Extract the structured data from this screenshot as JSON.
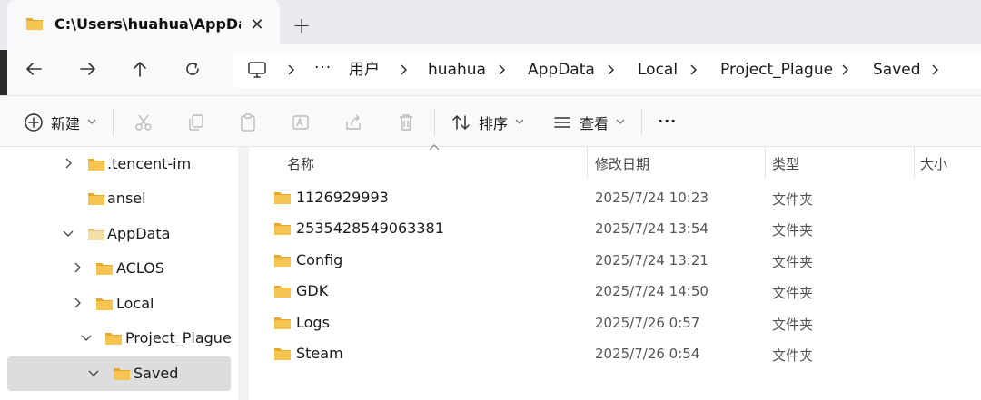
{
  "tab": {
    "title": "C:\\Users\\huahua\\AppData\\",
    "close_glyph": "✕",
    "new_tab_glyph": "+"
  },
  "nav": {
    "back_icon": "arrow-left-icon",
    "forward_icon": "arrow-right-icon",
    "up_icon": "arrow-up-icon",
    "refresh_icon": "refresh-icon"
  },
  "address": {
    "overflow": "···",
    "crumbs": [
      "用户",
      "huahua",
      "AppData",
      "Local",
      "Project_Plague",
      "Saved"
    ]
  },
  "toolbar": {
    "new_label": "新建",
    "sort_label": "排序",
    "view_label": "查看",
    "more_label": "···"
  },
  "sidebar": {
    "items": [
      {
        "label": ".tencent-im"
      },
      {
        "label": "ansel"
      },
      {
        "label": "AppData"
      },
      {
        "label": "ACLOS"
      },
      {
        "label": "Local"
      },
      {
        "label": "Project_Plague"
      },
      {
        "label": "Saved"
      }
    ]
  },
  "columns": {
    "name": "名称",
    "modified": "修改日期",
    "type": "类型",
    "size": "大小"
  },
  "files": [
    {
      "name": "1126929993",
      "modified": "2025/7/24 10:23",
      "type": "文件夹"
    },
    {
      "name": "2535428549063381",
      "modified": "2025/7/24 13:54",
      "type": "文件夹"
    },
    {
      "name": "Config",
      "modified": "2025/7/24 13:21",
      "type": "文件夹"
    },
    {
      "name": "GDK",
      "modified": "2025/7/24 14:50",
      "type": "文件夹"
    },
    {
      "name": "Logs",
      "modified": "2025/7/26 0:57",
      "type": "文件夹"
    },
    {
      "name": "Steam",
      "modified": "2025/7/26 0:54",
      "type": "文件夹"
    }
  ],
  "colors": {
    "folder": "#f5c451",
    "folder_dark": "#e8a92a",
    "selected": "#dddddd"
  }
}
